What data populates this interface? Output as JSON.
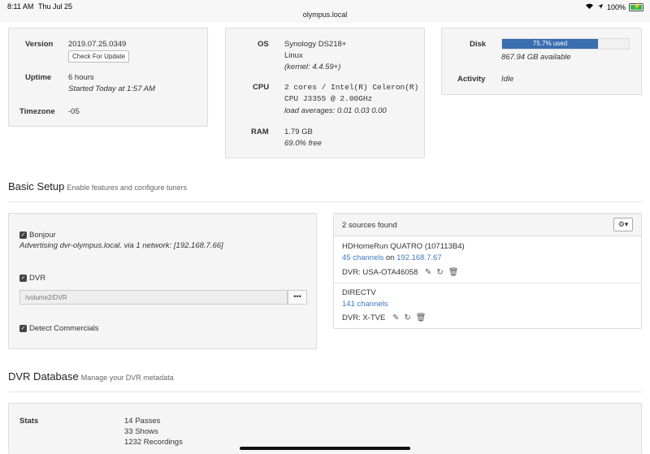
{
  "status_bar": {
    "time": "8:11 AM",
    "date": "Thu Jul 25",
    "host": "olympus.local",
    "battery": "100%",
    "battery_level": 1.0
  },
  "system": {
    "version_label": "Version",
    "version_value": "2019.07.25.0349",
    "check_update_label": "Check For Update",
    "uptime_label": "Uptime",
    "uptime_value": "6 hours",
    "uptime_started": "Started Today at 1:57 AM",
    "timezone_label": "Timezone",
    "timezone_value": "-05",
    "os_label": "OS",
    "os_line1": "Synology DS218+",
    "os_line2": "Linux",
    "os_kernel": "(kernel: 4.4.59+)",
    "cpu_label": "CPU",
    "cpu_line1": "2 cores / Intel(R) Celeron(R)",
    "cpu_line2": "CPU J3355 @ 2.00GHz",
    "cpu_load": "load averages:  0.01  0.03  0.00",
    "ram_label": "RAM",
    "ram_value": "1.79 GB",
    "ram_free": "69.0% free",
    "disk_label": "Disk",
    "disk_used_text": "75.7% used",
    "disk_used_fraction": 0.757,
    "disk_available": "867.94 GB available",
    "activity_label": "Activity",
    "activity_value": "Idle"
  },
  "basic_setup": {
    "title": "Basic Setup",
    "subtitle": "Enable features and configure tuners",
    "bonjour_label": "Bonjour",
    "bonjour_desc": "Advertising dvr-olympus.local. via 1 network: [192.168.7.66]",
    "dvr_label": "DVR",
    "dvr_path_placeholder": "/volume2/DVR",
    "path_button": "•••",
    "detect_label": "Detect Commercials"
  },
  "sources": {
    "header": "2 sources found",
    "gear_icon": "gear-icon",
    "items": [
      {
        "name": "HDHomeRun QUATRO (107113B4)",
        "channels_link": "45 channels",
        "on_text": "on",
        "ip_link": "192.168.7.67",
        "dvr_line": "DVR: USA-OTA46058"
      },
      {
        "name": "DIRECTV",
        "channels_link": "141 channels",
        "dvr_line": "DVR: X-TVE"
      }
    ]
  },
  "dvr_database": {
    "title": "DVR Database",
    "subtitle": "Manage your DVR metadata",
    "stats_label": "Stats",
    "passes": "14 Passes",
    "shows": "33 Shows",
    "recordings": "1232 Recordings"
  }
}
